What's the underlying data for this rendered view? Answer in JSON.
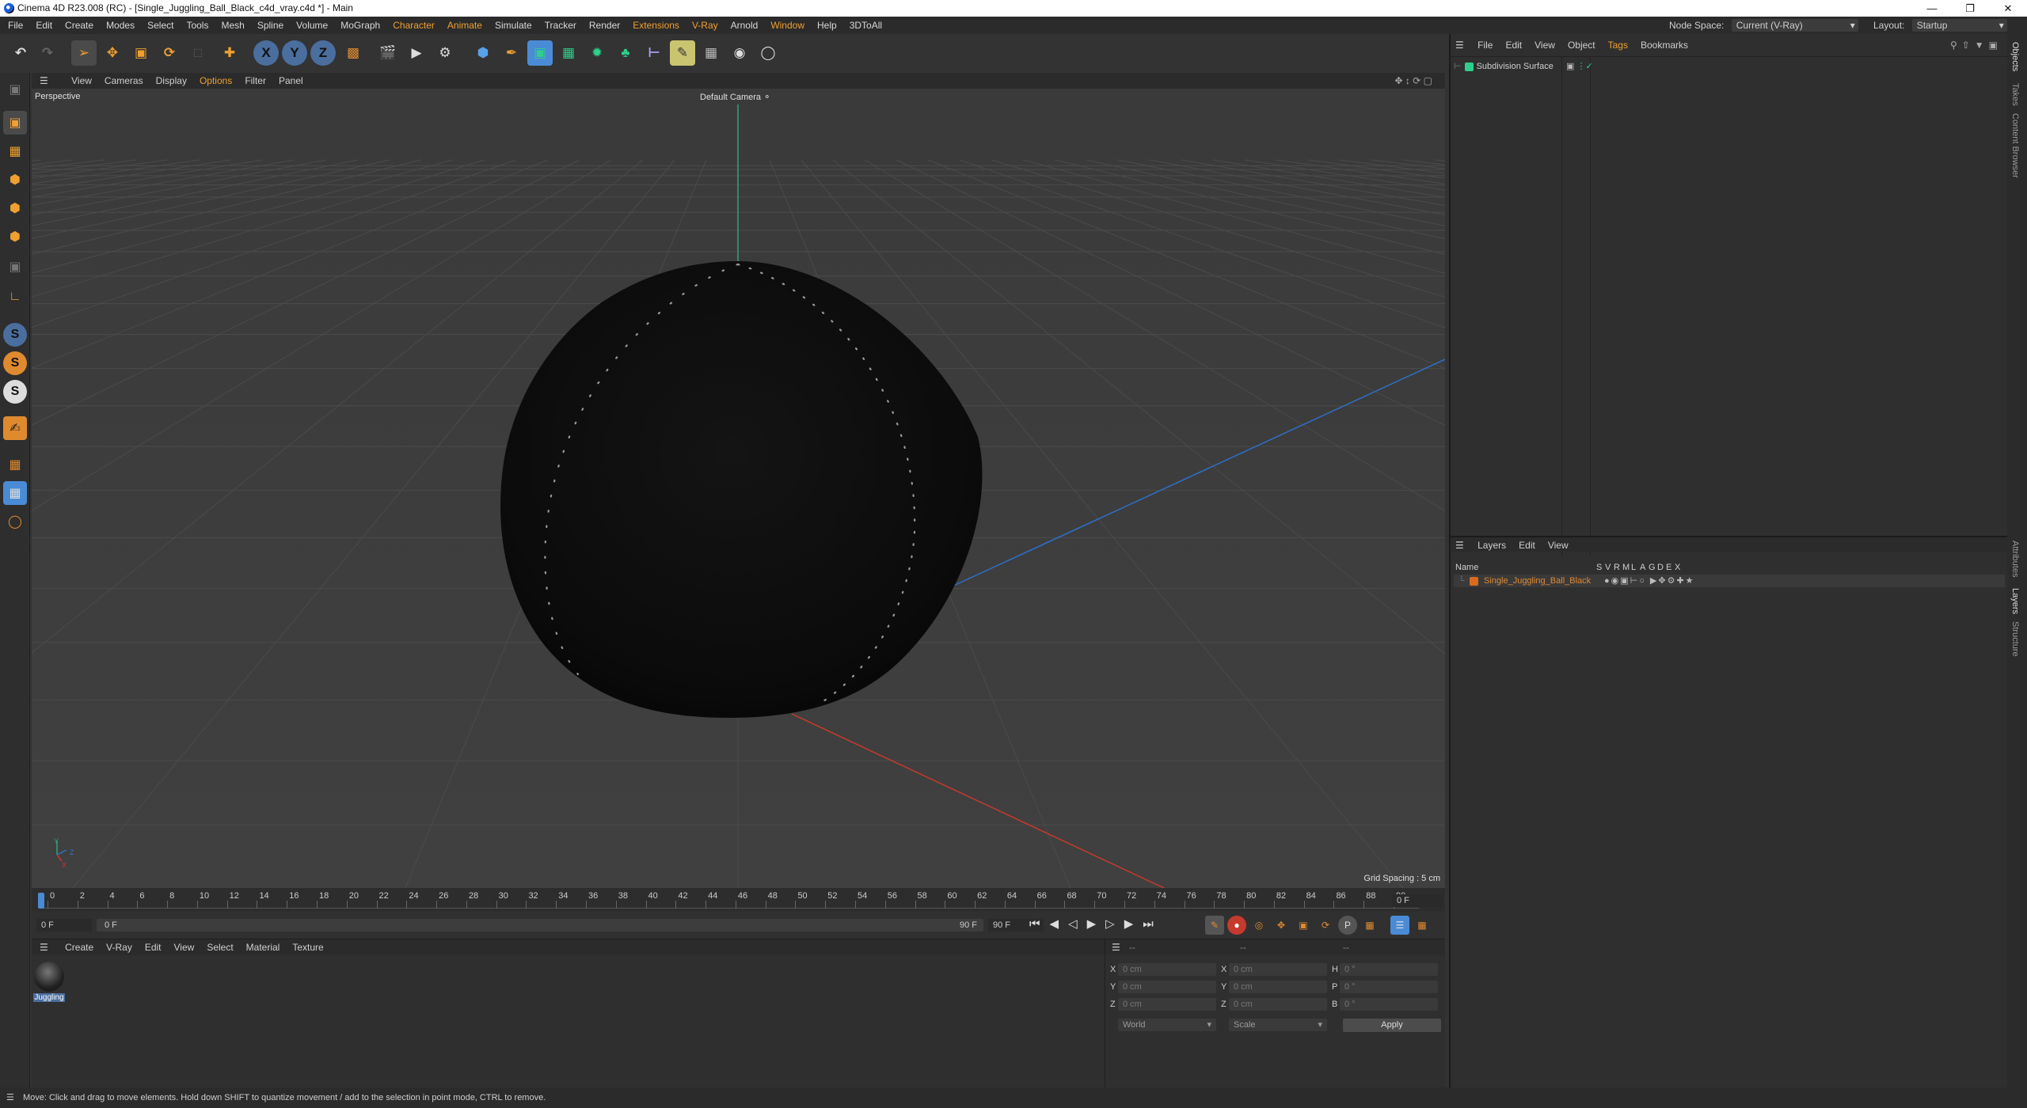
{
  "window": {
    "title": "Cinema 4D R23.008 (RC) - [Single_Juggling_Ball_Black_c4d_vray.c4d *] - Main"
  },
  "menu": [
    "File",
    "Edit",
    "Create",
    "Modes",
    "Select",
    "Tools",
    "Mesh",
    "Spline",
    "Volume",
    "MoGraph",
    "Character",
    "Animate",
    "Simulate",
    "Tracker",
    "Render",
    "Extensions",
    "V-Ray",
    "Arnold",
    "Window",
    "Help",
    "3DToAll"
  ],
  "menu_highlight": [
    "Character",
    "Animate",
    "Extensions",
    "V-Ray",
    "Window"
  ],
  "nodespace": {
    "label": "Node Space:",
    "value": "Current (V-Ray)"
  },
  "layout": {
    "label": "Layout:",
    "value": "Startup"
  },
  "toolbar_icons": [
    "undo-icon",
    "redo-icon",
    "select-cursor-icon",
    "move-icon",
    "scale-icon",
    "rotate-icon",
    "last-tool-icon",
    "move-plus-icon",
    "x-axis-icon",
    "y-axis-icon",
    "z-axis-icon",
    "coordinate-system-icon",
    "render-region-icon",
    "render-view-icon",
    "render-settings-icon",
    "cube-icon",
    "pen-icon",
    "subdivision-icon",
    "extrude-icon",
    "cloner-icon",
    "array-icon",
    "deformer-icon",
    "floor-icon",
    "tag-icon",
    "grid-icon",
    "camera-icon",
    "light-icon"
  ],
  "viewport": {
    "menu": [
      "View",
      "Cameras",
      "Display",
      "Options",
      "Filter",
      "Panel"
    ],
    "label": "Perspective",
    "camera": "Default Camera",
    "grid_spacing": "Grid Spacing : 5 cm",
    "axis_x": "X",
    "axis_y": "Y",
    "axis_z": "Z"
  },
  "timeline": {
    "ticks": [
      "0",
      "2",
      "4",
      "6",
      "8",
      "10",
      "12",
      "14",
      "16",
      "18",
      "20",
      "22",
      "24",
      "26",
      "28",
      "30",
      "32",
      "34",
      "36",
      "38",
      "40",
      "42",
      "44",
      "46",
      "48",
      "50",
      "52",
      "54",
      "56",
      "58",
      "60",
      "62",
      "64",
      "66",
      "68",
      "70",
      "72",
      "74",
      "76",
      "78",
      "80",
      "82",
      "84",
      "86",
      "88",
      "90"
    ],
    "current": "0 F",
    "start": "0 F",
    "range_start": "0 F",
    "range_end": "90 F",
    "end": "90 F"
  },
  "materials": {
    "menu": [
      "Create",
      "V-Ray",
      "Edit",
      "View",
      "Select",
      "Material",
      "Texture"
    ],
    "items": [
      {
        "name": "Juggling"
      }
    ]
  },
  "coordinates": {
    "header": [
      "--",
      "--",
      "--"
    ],
    "rows": [
      {
        "a": "X",
        "av": "0 cm",
        "b": "X",
        "bv": "0 cm",
        "c": "H",
        "cv": "0 °"
      },
      {
        "a": "Y",
        "av": "0 cm",
        "b": "Y",
        "bv": "0 cm",
        "c": "P",
        "cv": "0 °"
      },
      {
        "a": "Z",
        "av": "0 cm",
        "b": "Z",
        "bv": "0 cm",
        "c": "B",
        "cv": "0 °"
      }
    ],
    "mode1": "World",
    "mode2": "Scale",
    "apply": "Apply"
  },
  "objects": {
    "menu": [
      "File",
      "Edit",
      "View",
      "Object",
      "Tags",
      "Bookmarks"
    ],
    "items": [
      {
        "name": "Subdivision Surface"
      }
    ]
  },
  "layers": {
    "menu": [
      "Layers",
      "Edit",
      "View"
    ],
    "columns": [
      "Name",
      "S",
      "V",
      "R",
      "M",
      "L",
      "A",
      "G",
      "D",
      "E",
      "X"
    ],
    "items": [
      {
        "name": "Single_Juggling_Ball_Black",
        "color": "#d96a1d"
      }
    ]
  },
  "side_tabs_top": [
    "Objects",
    "Takes",
    "Content Browser"
  ],
  "side_tabs_bottom": [
    "Attributes",
    "Layers",
    "Structure"
  ],
  "status": "Move: Click and drag to move elements. Hold down SHIFT to quantize movement / add to the selection in point mode, CTRL to remove.",
  "colors": {
    "accent": "#f0a030",
    "highlight_blue": "#4a8bd6",
    "x_axis": "#c63a2e",
    "y_axis": "#2fa37a",
    "z_axis": "#2f6fc6"
  }
}
